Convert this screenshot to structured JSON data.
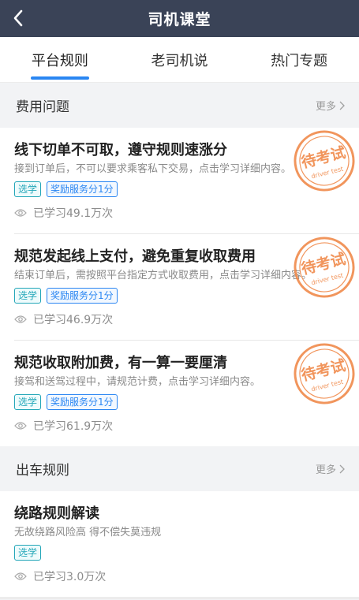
{
  "header": {
    "title": "司机课堂"
  },
  "tabs": [
    {
      "label": "平台规则",
      "active": true
    },
    {
      "label": "老司机说",
      "active": false
    },
    {
      "label": "热门专题",
      "active": false
    }
  ],
  "sections": [
    {
      "title": "费用问题",
      "more": "更多",
      "items": [
        {
          "title": "线下切单不可取，遵守规则速涨分",
          "desc": "接到订单后，不可以要求乘客私下交易，点击学习详细内容。",
          "badges": [
            "选学",
            "奖励服务分1分"
          ],
          "views": "已学习49.1万次",
          "stamp": {
            "text": "待考试",
            "sub": "driver test"
          }
        },
        {
          "title": "规范发起线上支付，避免重复收取费用",
          "desc": "结束订单后，需按照平台指定方式收取费用，点击学习详细内容。",
          "badges": [
            "选学",
            "奖励服务分1分"
          ],
          "views": "已学习46.9万次",
          "stamp": {
            "text": "待考试",
            "sub": "driver test"
          }
        },
        {
          "title": "规范收取附加费，有一算一要厘清",
          "desc": "接驾和送驾过程中，请规范计费，点击学习详细内容。",
          "badges": [
            "选学",
            "奖励服务分1分"
          ],
          "views": "已学习61.9万次",
          "stamp": {
            "text": "待考试",
            "sub": "driver test"
          }
        }
      ]
    },
    {
      "title": "出车规则",
      "more": "更多",
      "items": [
        {
          "title": "绕路规则解读",
          "desc": "无故绕路风险高 得不偿失莫违规",
          "badges": [
            "选学"
          ],
          "views": "已学习3.0万次"
        }
      ]
    }
  ],
  "colors": {
    "header_bg": "#3a4357",
    "accent": "#2a86f2",
    "stamp": "#f08a4b",
    "elective": "#22a6b8"
  }
}
